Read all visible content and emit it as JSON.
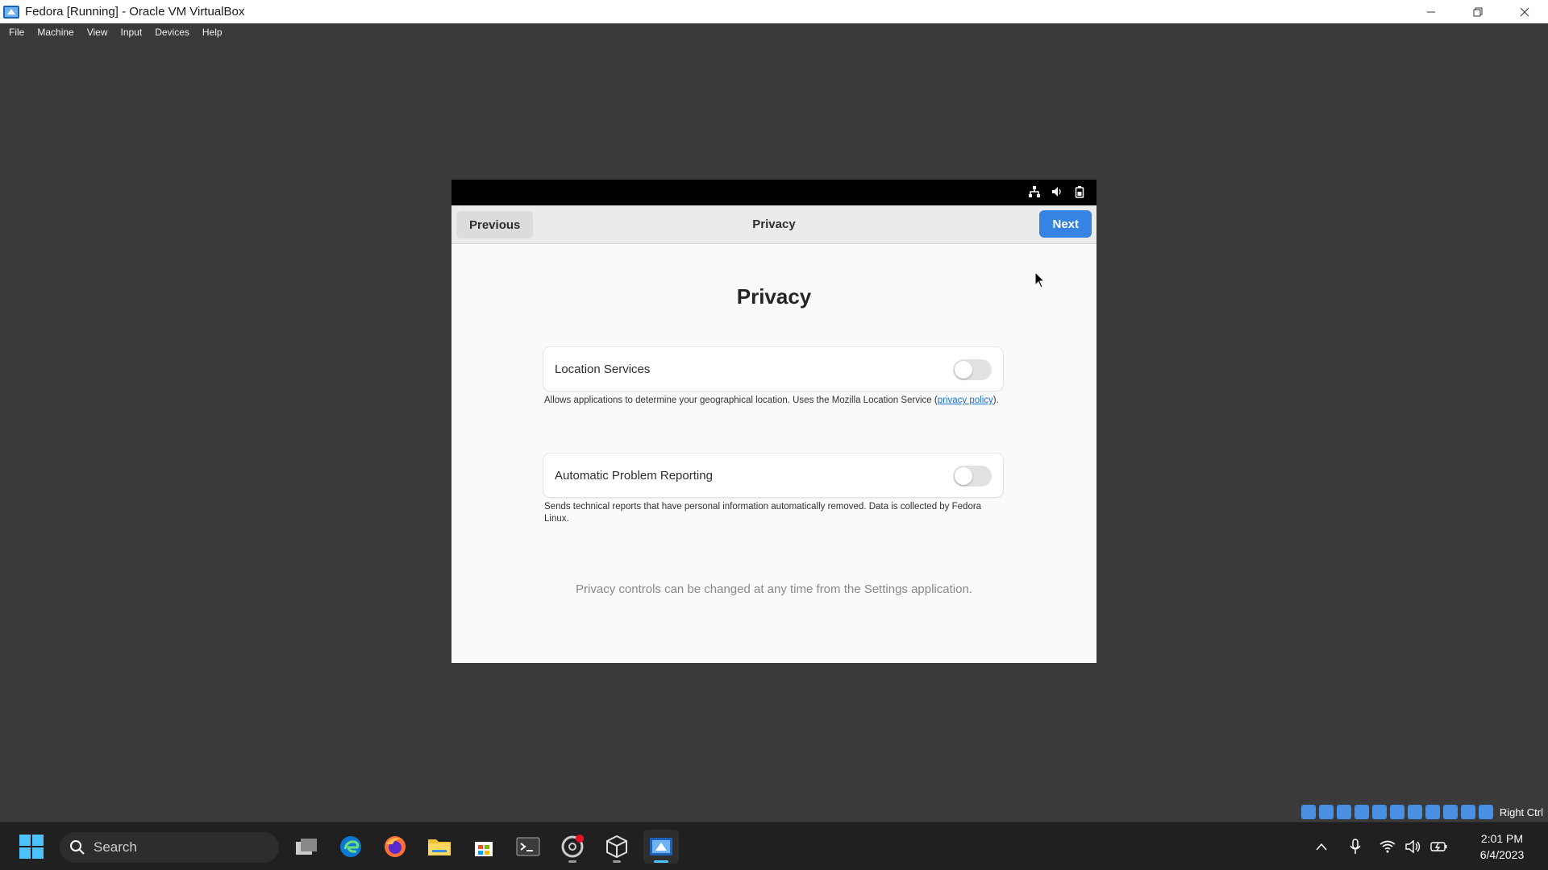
{
  "window": {
    "title": "Fedora [Running] - Oracle VM VirtualBox"
  },
  "menubar": {
    "items": [
      "File",
      "Machine",
      "View",
      "Input",
      "Devices",
      "Help"
    ]
  },
  "guest": {
    "headerbar": {
      "previous_label": "Previous",
      "title": "Privacy",
      "next_label": "Next"
    },
    "page": {
      "heading": "Privacy",
      "settings": [
        {
          "label": "Location Services",
          "enabled": false,
          "description": "Allows applications to determine your geographical location. Uses the Mozilla Location Service (",
          "link": "privacy policy",
          "description_end": ")."
        },
        {
          "label": "Automatic Problem Reporting",
          "enabled": false,
          "description": "Sends technical reports that have personal information automatically removed. Data is collected by Fedora Linux."
        }
      ],
      "footer_note": "Privacy controls can be changed at any time from the Settings application."
    }
  },
  "vbox_status": {
    "host_key": "Right Ctrl"
  },
  "taskbar": {
    "search_label": "Search",
    "clock_time": "2:01 PM",
    "clock_date": "6/4/2023"
  },
  "colors": {
    "accent": "#3584e4",
    "link": "#1c71d8",
    "taskbar_active": "#4cc2ff"
  }
}
